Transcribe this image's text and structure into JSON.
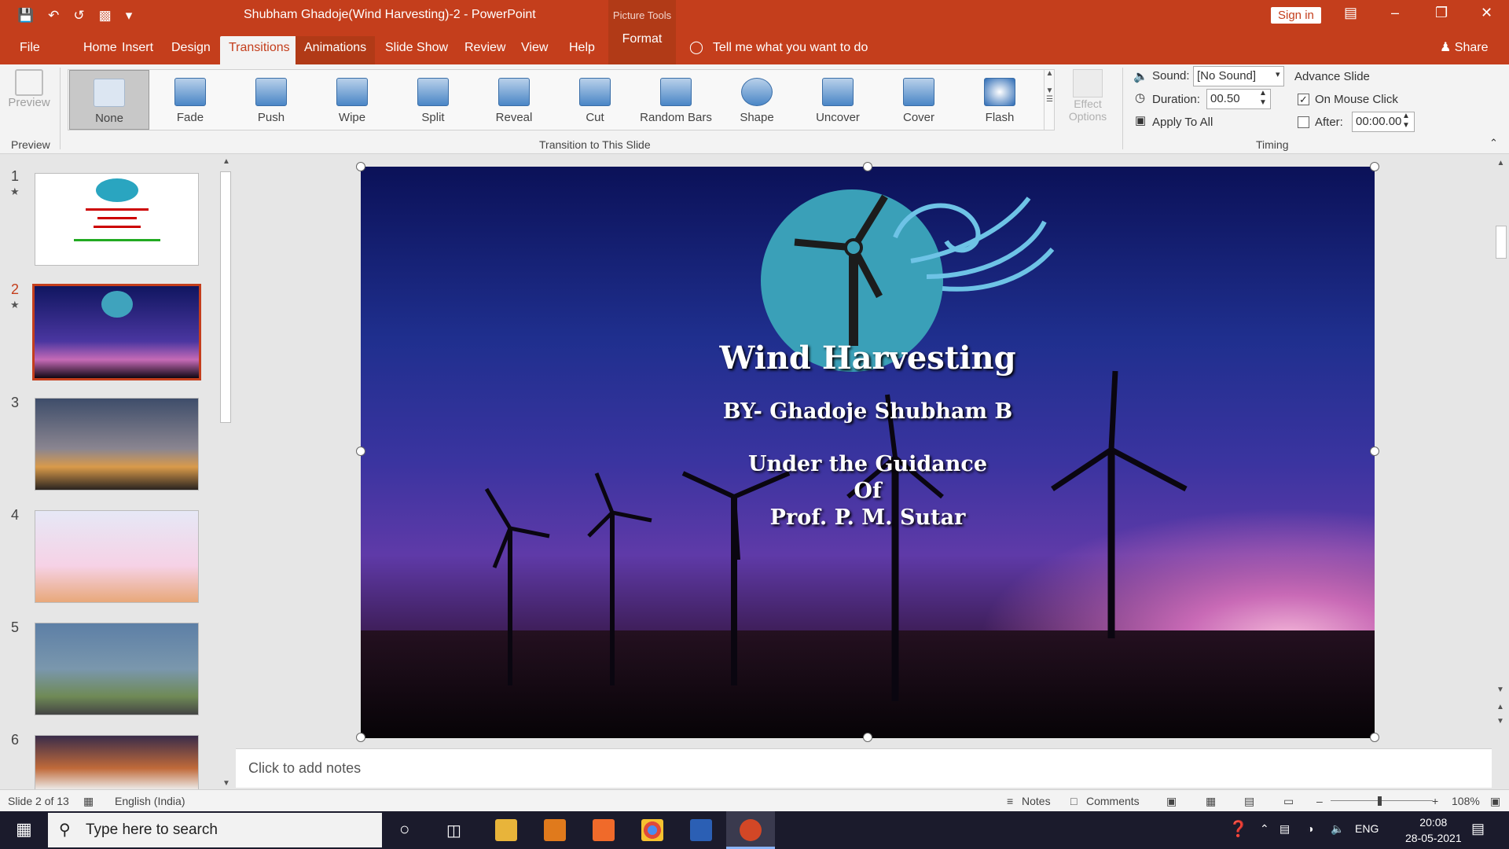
{
  "window": {
    "title": "Shubham Ghadoje(Wind Harvesting)-2  -  PowerPoint",
    "context_group": "Picture Tools",
    "sign_in": "Sign in"
  },
  "tabs": [
    "File",
    "Home",
    "Insert",
    "Design",
    "Transitions",
    "Animations",
    "Slide Show",
    "Review",
    "View",
    "Help",
    "Format"
  ],
  "tell_me": "Tell me what you want to do",
  "share": "Share",
  "ribbon": {
    "preview_label": "Preview",
    "preview_group": "Preview",
    "transitions": [
      "None",
      "Fade",
      "Push",
      "Wipe",
      "Split",
      "Reveal",
      "Cut",
      "Random Bars",
      "Shape",
      "Uncover",
      "Cover",
      "Flash"
    ],
    "selected_transition": "None",
    "effect_options": "Effect Options",
    "transition_group": "Transition to This Slide",
    "sound_label": "Sound:",
    "sound_value": "[No Sound]",
    "duration_label": "Duration:",
    "duration_value": "00.50",
    "apply_all": "Apply To All",
    "advance_label": "Advance Slide",
    "on_mouse_click": "On Mouse Click",
    "on_mouse_click_checked": true,
    "after_label": "After:",
    "after_value": "00:00.00",
    "after_checked": false,
    "timing_group": "Timing"
  },
  "thumbnails": [
    {
      "num": "1",
      "star": true
    },
    {
      "num": "2",
      "star": true,
      "selected": true
    },
    {
      "num": "3",
      "star": false
    },
    {
      "num": "4",
      "star": false
    },
    {
      "num": "5",
      "star": false
    },
    {
      "num": "6",
      "star": false
    }
  ],
  "slide": {
    "title": "Wind Harvesting",
    "by": "BY- Ghadoje Shubham B",
    "guidance_1": "Under the Guidance",
    "guidance_2": "Of",
    "guidance_3": "Prof. P. M. Sutar"
  },
  "notes_placeholder": "Click to add notes",
  "status": {
    "slide_count": "Slide 2 of 13",
    "language": "English (India)",
    "notes": "Notes",
    "comments": "Comments",
    "zoom": "108%"
  },
  "taskbar": {
    "search_placeholder": "Type here to search",
    "lang": "ENG",
    "time": "20:08",
    "date": "28-05-2021"
  },
  "colors": {
    "accent": "#c43e1c",
    "ribbon_bg": "#f3f3f3",
    "taskbar": "#1b1b2c"
  }
}
